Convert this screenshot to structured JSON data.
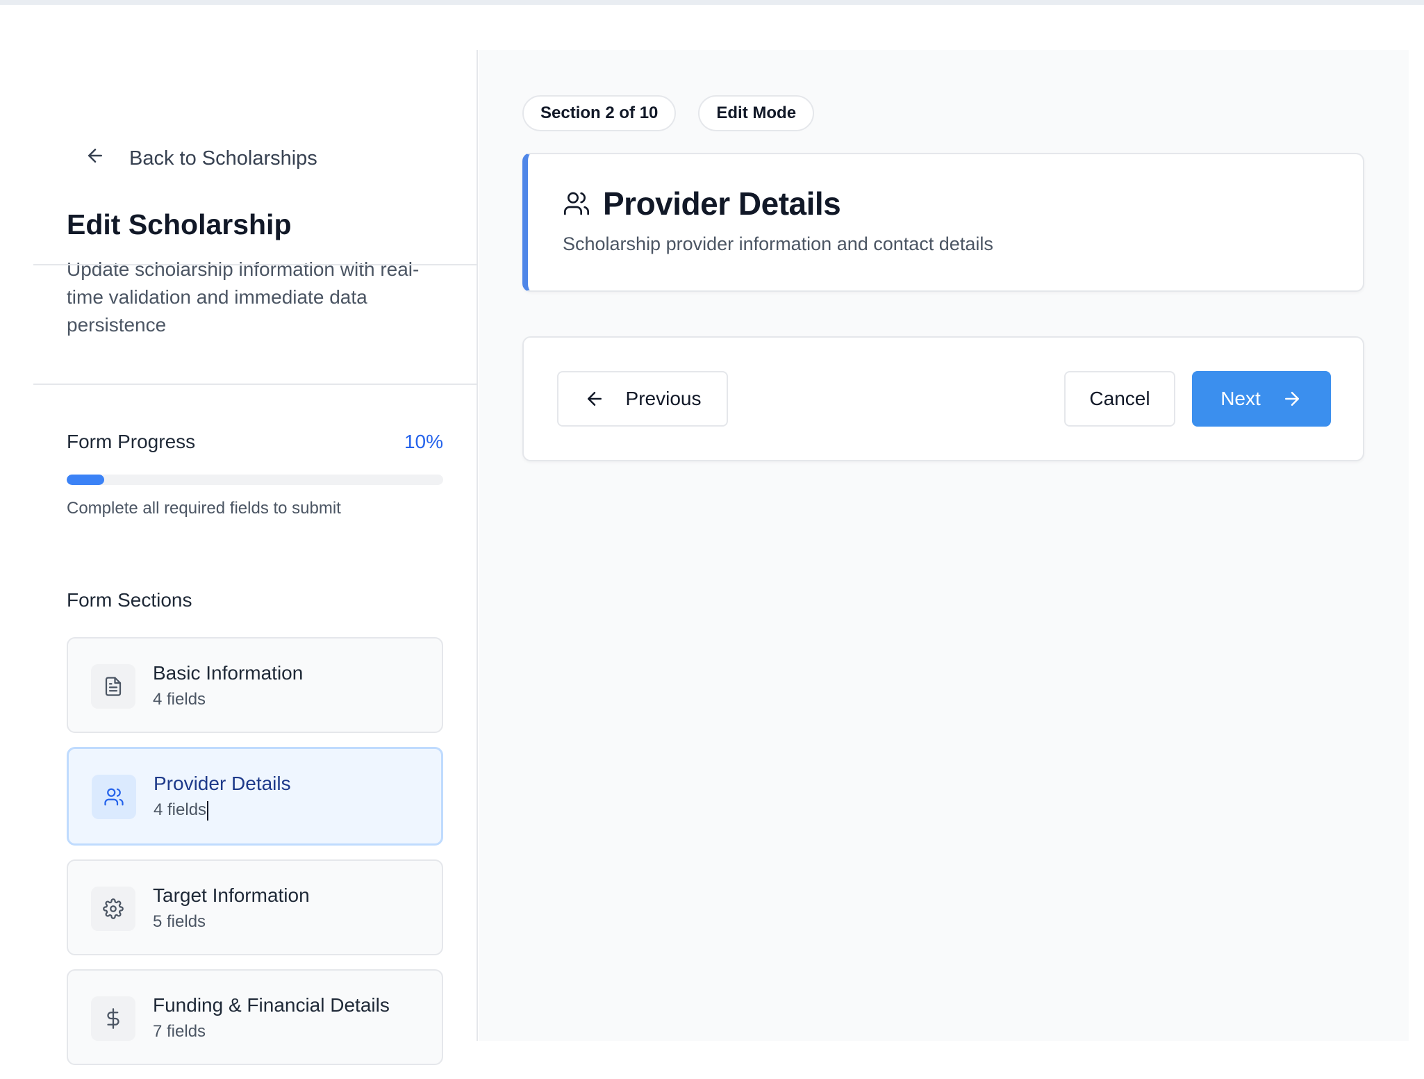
{
  "sidebar": {
    "back_label": "Back to Scholarships",
    "title": "Edit Scholarship",
    "subtitle": "Update scholarship information with real-time validation and immediate data persistence",
    "progress": {
      "label": "Form Progress",
      "percent_text": "10%",
      "value": 0.1,
      "hint": "Complete all required fields to submit"
    },
    "sections_label": "Form Sections",
    "sections": [
      {
        "name": "Basic Information",
        "count": "4 fields",
        "icon": "document-icon"
      },
      {
        "name": "Provider Details",
        "count": "4 fields",
        "icon": "users-icon",
        "active": true
      },
      {
        "name": "Target Information",
        "count": "5 fields",
        "icon": "gear-icon"
      },
      {
        "name": "Funding & Financial Details",
        "count": "7 fields",
        "icon": "dollar-icon"
      }
    ]
  },
  "main": {
    "pills": {
      "section": "Section 2 of 10",
      "mode": "Edit Mode"
    },
    "header": {
      "title": "Provider Details",
      "description": "Scholarship provider information and contact details",
      "icon": "users-icon"
    },
    "nav": {
      "previous_label": "Previous",
      "cancel_label": "Cancel",
      "next_label": "Next"
    }
  },
  "colors": {
    "accent": "#3b82f6",
    "next_button": "#3b8fee",
    "active_border": "#bfdbfe",
    "active_bg": "#eff6ff"
  }
}
